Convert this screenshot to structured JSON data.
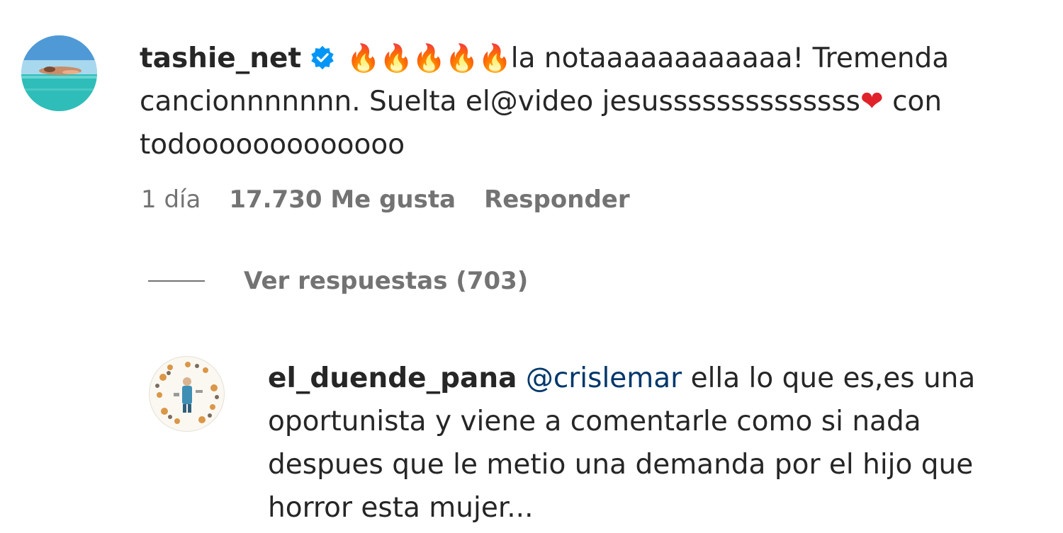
{
  "main_comment": {
    "username": "tashie_net",
    "verified": true,
    "fire_emoji": "🔥",
    "fire_count": 5,
    "text_part1": "la notaaaaaaaaaaaa! Tremenda cancionnnnnnn. Suelta el@video jesussssssssssssss",
    "heart_emoji": "❤",
    "text_part2": " con todooooooooooooo",
    "time": "1 día",
    "likes": "17.730 Me gusta",
    "reply_label": "Responder"
  },
  "view_replies": {
    "label": "Ver respuestas (703)"
  },
  "reply": {
    "username": "el_duende_pana",
    "mention": "@crislemar",
    "text": " ella lo que es,es una oportunista y viene a comentarle como si nada despues que le metio una demanda por el hijo que horror esta mujer..."
  },
  "colors": {
    "text": "#262626",
    "muted": "#737373",
    "verified_blue": "#0095f6",
    "mention": "#00376b",
    "heart": "#e0222b"
  },
  "icons": {
    "verified": "verified-badge-icon",
    "fire": "fire-emoji-icon",
    "heart": "heart-emoji-icon"
  }
}
